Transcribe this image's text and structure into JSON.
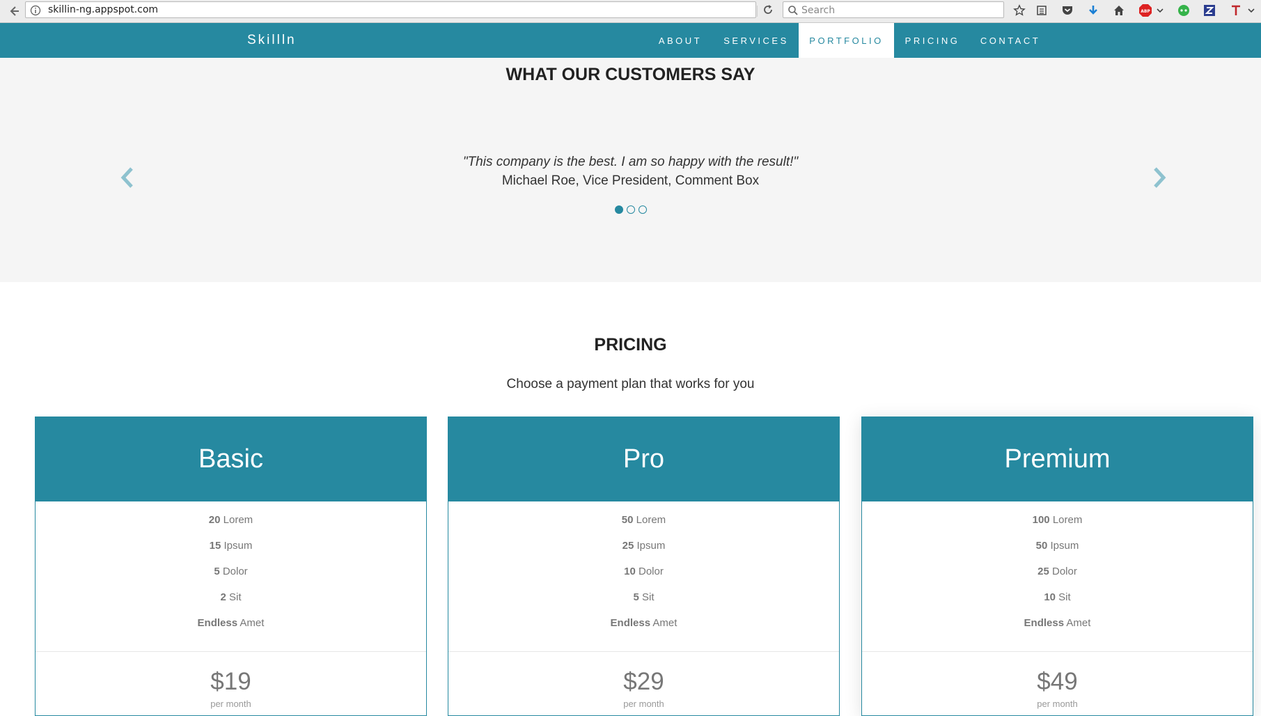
{
  "browser": {
    "url": "skillin-ng.appspot.com",
    "search_placeholder": "Search",
    "abp_badge": "ABP"
  },
  "nav": {
    "brand": "Skillln",
    "items": [
      {
        "label": "ABOUT"
      },
      {
        "label": "SERVICES"
      },
      {
        "label": "PORTFOLIO",
        "active": true
      },
      {
        "label": "PRICING"
      },
      {
        "label": "CONTACT"
      }
    ]
  },
  "testimonials": {
    "title": "WHAT OUR CUSTOMERS SAY",
    "quote": "\"This company is the best. I am so happy with the result!\"",
    "author": "Michael Roe, Vice President, Comment Box",
    "slides": 3,
    "active_slide": 1
  },
  "pricing": {
    "title": "PRICING",
    "subtitle": "Choose a payment plan that works for you",
    "plans": [
      {
        "name": "Basic",
        "features": [
          {
            "qty": "20",
            "label": "Lorem"
          },
          {
            "qty": "15",
            "label": "Ipsum"
          },
          {
            "qty": "5",
            "label": "Dolor"
          },
          {
            "qty": "2",
            "label": "Sit"
          },
          {
            "qty": "Endless",
            "label": "Amet"
          }
        ],
        "price": "$19",
        "per": "per month"
      },
      {
        "name": "Pro",
        "features": [
          {
            "qty": "50",
            "label": "Lorem"
          },
          {
            "qty": "25",
            "label": "Ipsum"
          },
          {
            "qty": "10",
            "label": "Dolor"
          },
          {
            "qty": "5",
            "label": "Sit"
          },
          {
            "qty": "Endless",
            "label": "Amet"
          }
        ],
        "price": "$29",
        "per": "per month"
      },
      {
        "name": "Premium",
        "features": [
          {
            "qty": "100",
            "label": "Lorem"
          },
          {
            "qty": "50",
            "label": "Ipsum"
          },
          {
            "qty": "25",
            "label": "Dolor"
          },
          {
            "qty": "10",
            "label": "Sit"
          },
          {
            "qty": "Endless",
            "label": "Amet"
          }
        ],
        "price": "$49",
        "per": "per month"
      }
    ]
  },
  "colors": {
    "accent": "#2689a0",
    "section_bg": "#f5f5f5"
  },
  "icons": [
    "back-arrow-icon",
    "info-icon",
    "reload-icon",
    "search-icon",
    "bookmark-star-icon",
    "reading-list-icon",
    "pocket-icon",
    "download-icon",
    "home-icon",
    "adblock-icon",
    "chevron-down-icon",
    "chat-extension-icon",
    "zotero-icon",
    "t-extension-icon",
    "chevron-left-icon",
    "chevron-right-icon"
  ]
}
